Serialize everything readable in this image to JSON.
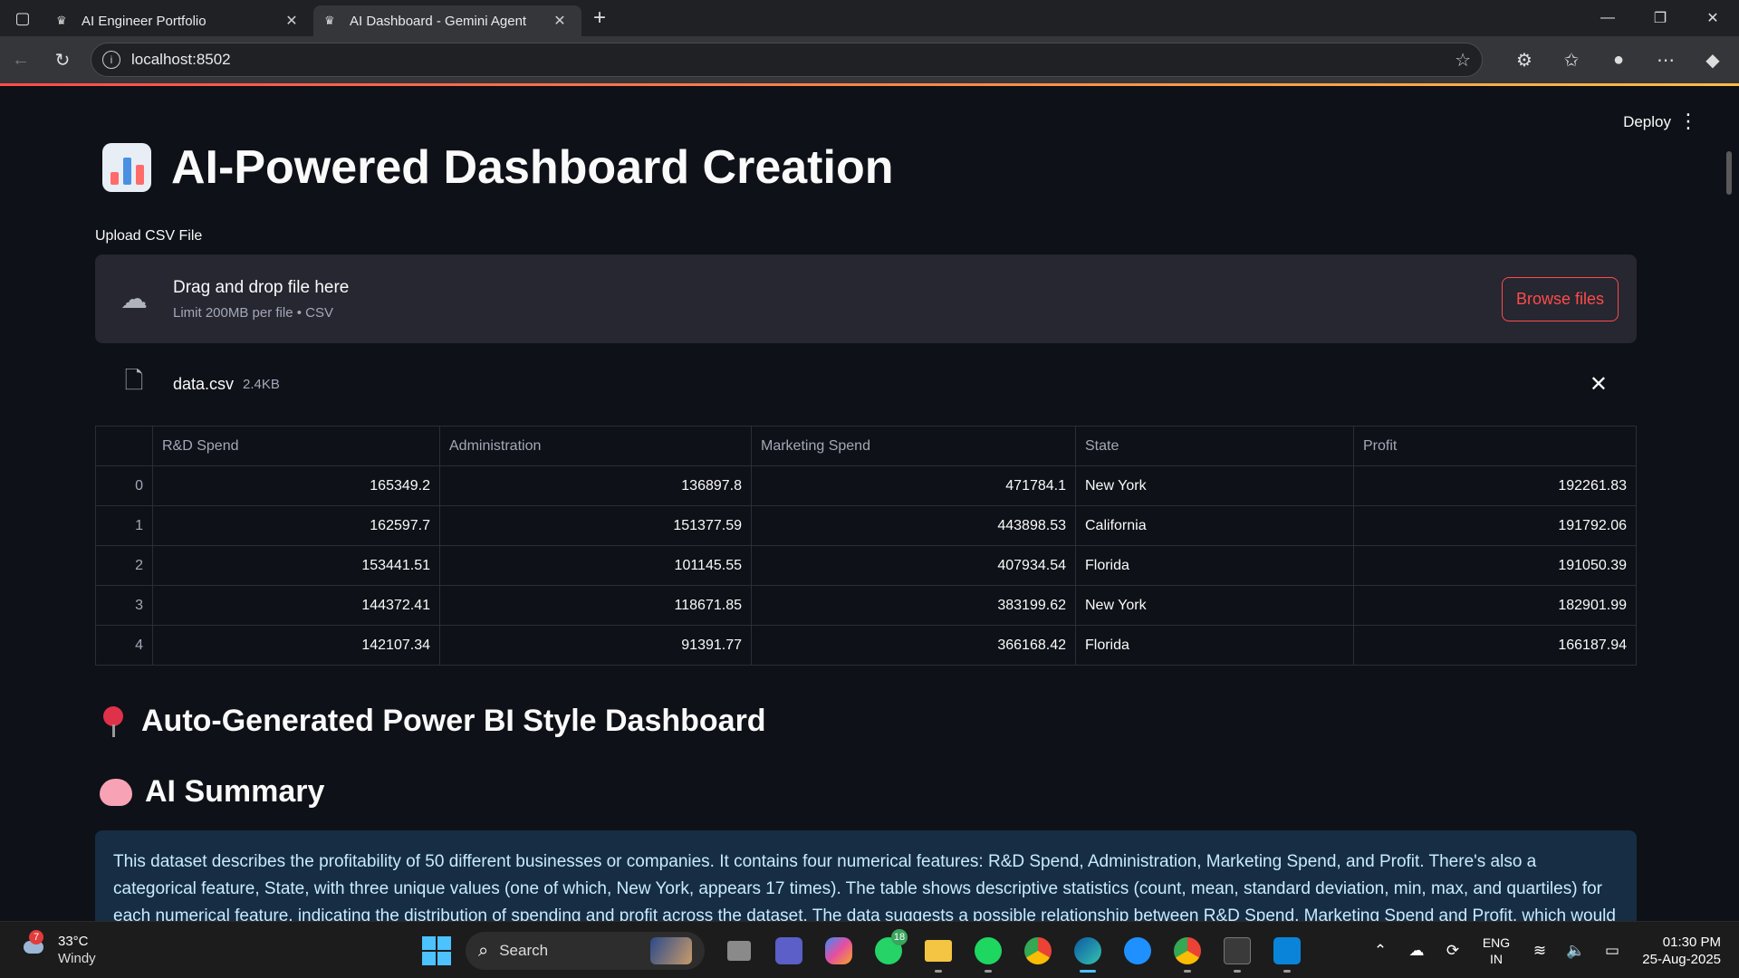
{
  "browser": {
    "tabs": [
      {
        "title": "AI Engineer Portfolio",
        "active": false
      },
      {
        "title": "AI Dashboard - Gemini Agent",
        "active": true
      }
    ],
    "url": "localhost:8502"
  },
  "app": {
    "deploy_label": "Deploy",
    "title": "AI-Powered Dashboard Creation",
    "upload_label": "Upload CSV File",
    "dropzone": {
      "title": "Drag and drop file here",
      "limit": "Limit 200MB per file • CSV",
      "browse_label": "Browse files"
    },
    "file": {
      "name": "data.csv",
      "size": "2.4KB"
    },
    "table": {
      "columns": [
        "",
        "R&D Spend",
        "Administration",
        "Marketing Spend",
        "State",
        "Profit"
      ],
      "rows": [
        [
          "0",
          "165349.2",
          "136897.8",
          "471784.1",
          "New York",
          "192261.83"
        ],
        [
          "1",
          "162597.7",
          "151377.59",
          "443898.53",
          "California",
          "191792.06"
        ],
        [
          "2",
          "153441.51",
          "101145.55",
          "407934.54",
          "Florida",
          "191050.39"
        ],
        [
          "3",
          "144372.41",
          "118671.85",
          "383199.62",
          "New York",
          "182901.99"
        ],
        [
          "4",
          "142107.34",
          "91391.77",
          "366168.42",
          "Florida",
          "166187.94"
        ]
      ]
    },
    "dashboard_heading": "Auto-Generated Power BI Style Dashboard",
    "summary_heading": "AI Summary",
    "summary_text": "This dataset describes the profitability of 50 different businesses or companies. It contains four numerical features: R&D Spend, Administration, Marketing Spend, and Profit. There's also a categorical feature, State, with three unique values (one of which, New York, appears 17 times). The table shows descriptive statistics (count, mean, standard deviation, min, max, and quartiles) for each numerical feature, indicating the distribution of spending and profit across the dataset. The data suggests a possible relationship between R&D Spend, Marketing Spend and Profit, which would likely be"
  },
  "taskbar": {
    "weather": {
      "temp": "33°C",
      "condition": "Windy",
      "badge": "7"
    },
    "search_placeholder": "Search",
    "whatsapp_badge": "18",
    "lang": {
      "line1": "ENG",
      "line2": "IN"
    },
    "time": "01:30 PM",
    "date": "25-Aug-2025"
  },
  "colors": {
    "accent": "#ff4b4b",
    "background": "#0e1117",
    "summary_bg": "#172d43"
  }
}
